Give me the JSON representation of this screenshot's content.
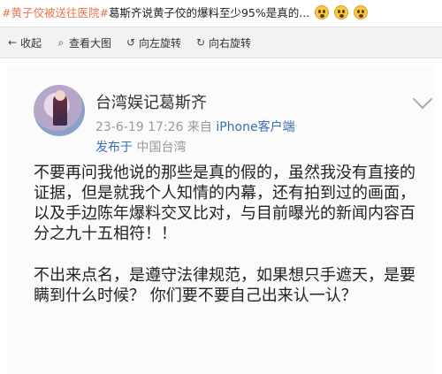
{
  "caption": {
    "hashtag": "#黄子佼被送往医院#",
    "headline": "葛斯齐说黄子佼的爆料至少95%是真的...",
    "emoji_icons": [
      "shocked-face-icon",
      "shocked-face-icon",
      "shocked-face-icon"
    ]
  },
  "toolbar": {
    "items": [
      {
        "icon": "←",
        "label": "收起"
      },
      {
        "icon": "⌕",
        "label": "查看大图"
      },
      {
        "icon": "↺",
        "label": "向左旋转"
      },
      {
        "icon": "↻",
        "label": "向右旋转"
      }
    ]
  },
  "post": {
    "username": "台湾娱记葛斯齐",
    "date": "23-6-19 17:26",
    "source_prefix": "来自",
    "client": "iPhone客户端",
    "location_prefix": "发布于",
    "location": "中国台湾",
    "paragraphs": [
      "不要再问我他说的那些是真的假的，虽然我没有直接的证据，但是就我个人知情的内幕，还有拍到过的画面，以及手边陈年爆料交叉比对，与目前曝光的新闻内容百分之九十五相符！！",
      "不出来点名，是遵守法律规范，如果想只手遮天，是要瞒到什么时候？ 你们要不要自己出来认一认？"
    ]
  }
}
